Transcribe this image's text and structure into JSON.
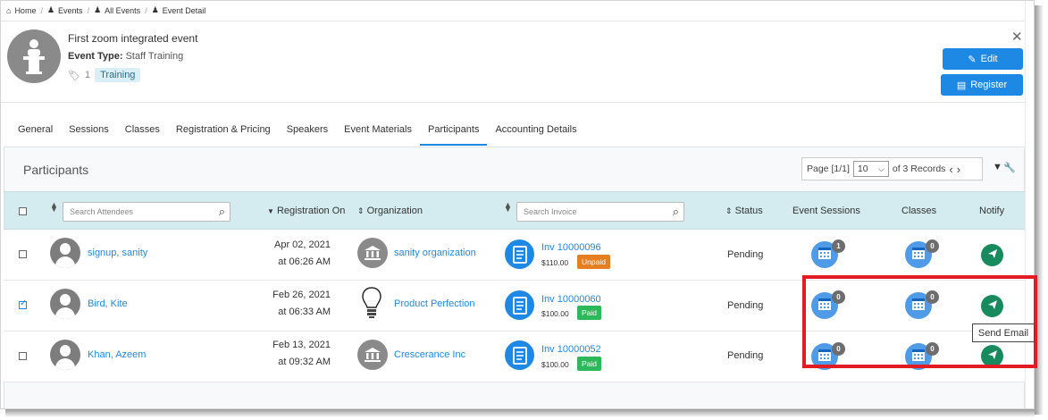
{
  "breadcrumb": [
    "Home",
    "Events",
    "All Events",
    "Event Detail"
  ],
  "event": {
    "title": "First zoom integrated event",
    "type_label": "Event Type:",
    "type_value": "Staff Training",
    "tag_count": "1",
    "tag": "Training"
  },
  "buttons": {
    "edit": "Edit",
    "register": "Register"
  },
  "tabs": [
    "General",
    "Sessions",
    "Classes",
    "Registration & Pricing",
    "Speakers",
    "Event Materials",
    "Participants",
    "Accounting Details"
  ],
  "active_tab": "Participants",
  "panel": {
    "title": "Participants",
    "page_label": "Page [1/1]",
    "page_size": "10",
    "records": "of 3 Records"
  },
  "table": {
    "search_attendees_placeholder": "Search Attendees",
    "registration_on": "Registration On",
    "organization": "Organization",
    "search_invoice_placeholder": "Search Invoice",
    "status": "Status",
    "event_sessions": "Event Sessions",
    "classes": "Classes",
    "notify": "Notify"
  },
  "rows": [
    {
      "name": "signup, sanity",
      "checked": false,
      "date": "Apr 02, 2021",
      "time": "at 06:26 AM",
      "org": "sanity organization",
      "org_icon": "bank-icon",
      "invoice": "Inv 10000096",
      "amount": "$110.00",
      "payment": "Unpaid",
      "status": "Pending",
      "sessions_count": "1",
      "classes_count": "0"
    },
    {
      "name": "Bird, Kite",
      "checked": true,
      "date": "Feb 26, 2021",
      "time": "at 06:33 AM",
      "org": "Product Perfection",
      "org_icon": "lightbulb-icon",
      "invoice": "Inv 10000060",
      "amount": "$100.00",
      "payment": "Paid",
      "status": "Pending",
      "sessions_count": "0",
      "classes_count": "0"
    },
    {
      "name": "Khan, Azeem",
      "checked": false,
      "date": "Feb 13, 2021",
      "time": "at 09:32 AM",
      "org": "Crescerance Inc",
      "org_icon": "bank-icon",
      "invoice": "Inv 10000052",
      "amount": "$100.00",
      "payment": "Paid",
      "status": "Pending",
      "sessions_count": "0",
      "classes_count": "0"
    }
  ],
  "tooltip": "Send Email",
  "colors": {
    "accent": "#1e88e5",
    "header_row": "#d4ecef",
    "notify": "#178a5e",
    "highlight": "#e31b23",
    "paid": "#2eb85c",
    "unpaid": "#e67e22"
  }
}
